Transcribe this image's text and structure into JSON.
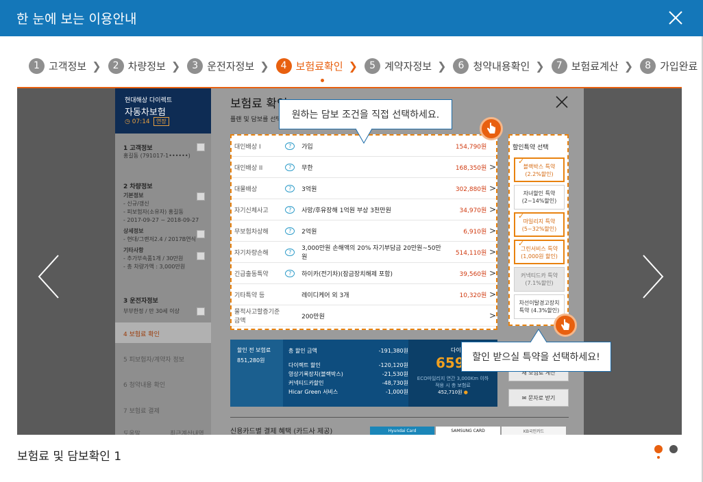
{
  "header": {
    "title": "한 눈에 보는 이용안내"
  },
  "steps": [
    {
      "num": "1",
      "label": "고객정보"
    },
    {
      "num": "2",
      "label": "차량정보"
    },
    {
      "num": "3",
      "label": "운전자정보"
    },
    {
      "num": "4",
      "label": "보험료확인"
    },
    {
      "num": "5",
      "label": "계약자정보"
    },
    {
      "num": "6",
      "label": "청약내용확인"
    },
    {
      "num": "7",
      "label": "보험료계산"
    },
    {
      "num": "8",
      "label": "가입완료"
    }
  ],
  "active_step": 4,
  "inner": {
    "side": {
      "brand": "현대해상 다이렉트",
      "product": "자동차보험",
      "timer": "07:14",
      "extend": "연장",
      "s1_title": "고객정보",
      "s1_value": "홍길동 (791017-1••••••)",
      "s2_title": "차량정보",
      "s2_basic": "기본정보",
      "s2_basic_1": "- 신규/갱신",
      "s2_basic_2": "- 피보험자(소유자) 홍길동",
      "s2_basic_3": "- 2017-09-27 ~ 2018-09-27",
      "s2_detail": "상세정보",
      "s2_detail_1": "- 현대/그랜저2.4 / 2017B연식",
      "s2_other": "기타사항",
      "s2_other_1": "- 추가부속품1개 / 30만원",
      "s2_other_2": "- 총 차량가액 : 3,000만원",
      "s3_title": "운전자정보",
      "s3_value": "부부한정 / 만 30세 이상",
      "s4": "보험료 확인",
      "s5": "피보험자/계약자 정보",
      "s6": "청약내용 확인",
      "s7": "보험료 결제",
      "help": "도움말",
      "recent": "최근계산내역"
    },
    "main": {
      "title": "보험료 확인",
      "subtitle": "플랜 및 담보를 선택"
    },
    "coverages": [
      {
        "name": "대인배상 I",
        "detail": "가입",
        "price": "154,790원",
        "q": true,
        "arrow": ""
      },
      {
        "name": "대인배상 II",
        "detail": "무한",
        "price": "168,350원",
        "q": true,
        "arrow": ">"
      },
      {
        "name": "대물배상",
        "detail": "3억원",
        "price": "302,880원",
        "q": true,
        "arrow": ">"
      },
      {
        "name": "자기신체사고",
        "detail": "사망/후유장해 1억원 부상 3천만원",
        "price": "34,970원",
        "q": true,
        "arrow": ">"
      },
      {
        "name": "무보험차상해",
        "detail": "2억원",
        "price": "6,910원",
        "q": true,
        "arrow": ">"
      },
      {
        "name": "자기차량손해",
        "detail": "3,000만원 손해액의 20% 자기부담금 20만원~50만원",
        "price": "514,110원",
        "q": true,
        "arrow": ">"
      },
      {
        "name": "긴급출동특약",
        "detail": "하이카(전기차)(잠금장치해제 포함)",
        "price": "39,560원",
        "q": true,
        "arrow": ">"
      },
      {
        "name": "기타특약 등",
        "detail": "레이디케어 외 3개",
        "price": "10,320원",
        "q": false,
        "arrow": ">"
      },
      {
        "name": "물적사고할증기준금액",
        "detail": "200만원",
        "price": "",
        "q": false,
        "arrow": ">"
      }
    ],
    "discount": {
      "title": "할인특약 선택",
      "items": [
        {
          "l1": "블랙박스 특약",
          "l2": "(2.2%할인)",
          "state": "sel"
        },
        {
          "l1": "자녀할인 특약",
          "l2": "(2~14%할인)",
          "state": ""
        },
        {
          "l1": "마일리지 특약",
          "l2": "(5~32%할인)",
          "state": "sel"
        },
        {
          "l1": "그린서비스 특약",
          "l2": "(1,000원 할인)",
          "state": "sel"
        },
        {
          "l1": "커넥티드카 특약",
          "l2": "(7.1%할인)",
          "state": "dim"
        },
        {
          "l1": "차선이탈경고장치",
          "l2": "특약 (4.3%할인)",
          "state": ""
        }
      ],
      "check_glyph": "✓"
    },
    "summary": {
      "pre_label": "할인 전 보험료",
      "pre_value": "851,280원",
      "total_label": "총 할인 금액",
      "total_value": "-191,380원",
      "rows": [
        {
          "k": "다이렉트 할인",
          "v": "-120,120원"
        },
        {
          "k": "영상기록장치(블랙박스)",
          "v": "-21,530원"
        },
        {
          "k": "커넥티드카할인",
          "v": "-48,730원"
        },
        {
          "k": "Hicar Green 서비스",
          "v": "-1,000원"
        }
      ],
      "right_label": "다이",
      "big": "659,",
      "eco1": "ECO마일리지 연간 3,000Km 이하",
      "eco2": "적용 시 총 보험료",
      "eco3": "452,710원"
    },
    "side_btn1": "재 보험료 계산",
    "side_btn2": "✉ 문자로 받기",
    "cards_title": "신용카드별 결제 혜택 (카드사 제공)",
    "card1": "Hyundai Card",
    "card2": "SAMSUNG CARD",
    "card3": "KB국민카드"
  },
  "tips": {
    "tip1": "원하는 담보 조건을 직접 선택하세요.",
    "tip2": "할인 받으실 특약을 선택하세요!"
  },
  "caption": "보험료 및 담보확인 1",
  "icons": {
    "close": "close-icon",
    "prev": "chevron-left-icon",
    "next": "chevron-right-icon",
    "hand": "hand-pointer-icon",
    "clock": "clock-icon",
    "pencil": "pencil-icon"
  },
  "colors": {
    "header": "#1477b9",
    "accent": "#e8600f"
  }
}
